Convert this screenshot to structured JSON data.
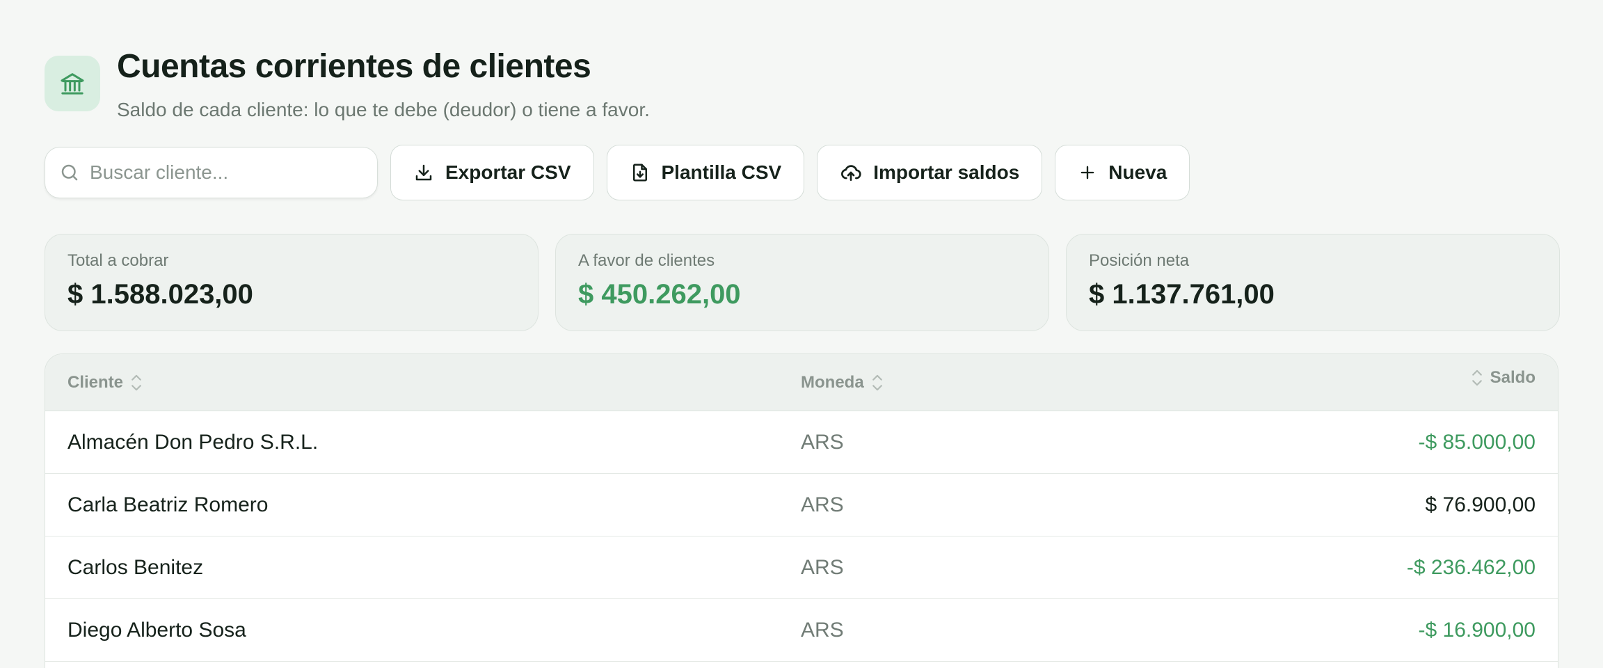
{
  "header": {
    "title": "Cuentas corrientes de clientes",
    "subtitle": "Saldo de cada cliente: lo que te debe (deudor) o tiene a favor.",
    "icon": "bank-icon"
  },
  "toolbar": {
    "search_placeholder": "Buscar cliente...",
    "export_label": "Exportar CSV",
    "template_label": "Plantilla CSV",
    "import_label": "Importar saldos",
    "new_label": "Nueva"
  },
  "stats": [
    {
      "label": "Total a cobrar",
      "value": "$ 1.588.023,00"
    },
    {
      "label": "A favor de clientes",
      "value": "$ 450.262,00"
    },
    {
      "label": "Posición neta",
      "value": "$ 1.137.761,00"
    }
  ],
  "table": {
    "columns": {
      "cliente": "Cliente",
      "moneda": "Moneda",
      "saldo": "Saldo"
    },
    "rows": [
      {
        "cliente": "Almacén Don Pedro S.R.L.",
        "moneda": "ARS",
        "saldo": "-$ 85.000,00"
      },
      {
        "cliente": "Carla Beatriz Romero",
        "moneda": "ARS",
        "saldo": "$ 76.900,00"
      },
      {
        "cliente": "Carlos Benitez",
        "moneda": "ARS",
        "saldo": "-$ 236.462,00"
      },
      {
        "cliente": "Diego Alberto Sosa",
        "moneda": "ARS",
        "saldo": "-$ 16.900,00"
      }
    ]
  },
  "colors": {
    "accent_green": "#3e9a5f",
    "icon_bg": "#d9eee1",
    "page_bg": "#f5f7f5"
  }
}
